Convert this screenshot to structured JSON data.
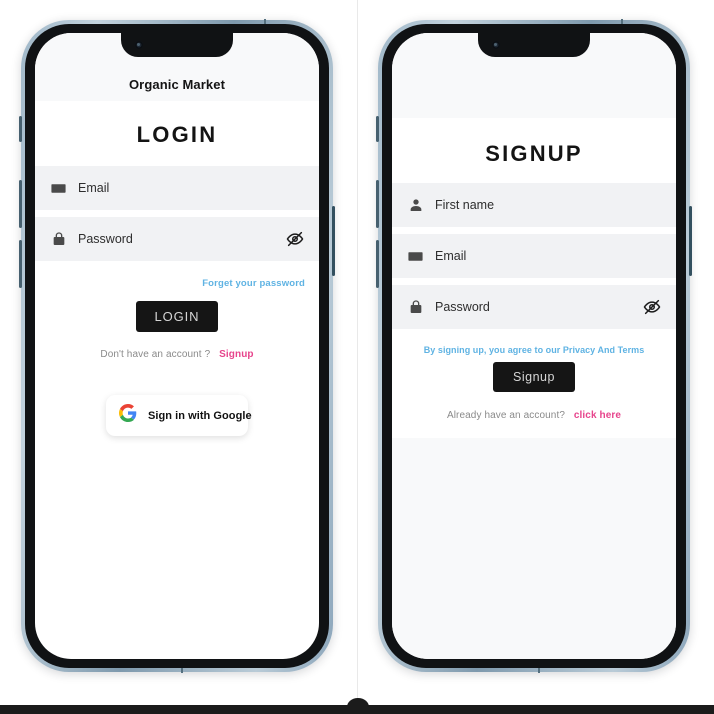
{
  "app": {
    "brand": "Organic Market"
  },
  "login_screen": {
    "title": "LOGIN",
    "fields": [
      {
        "icon": "envelope-icon",
        "label": "Email"
      },
      {
        "icon": "lock-icon",
        "label": "Password",
        "trailing_icon": "eye-off-icon"
      }
    ],
    "forgot_link": "Forget your password",
    "submit_label": "LOGIN",
    "footer_text": "Don't have an account ?",
    "footer_link": "Signup",
    "google_button": {
      "label": "Sign in with Google",
      "icon": "google-g-icon"
    }
  },
  "signup_screen": {
    "title": "SIGNUP",
    "fields": [
      {
        "icon": "person-icon",
        "label": "First name"
      },
      {
        "icon": "envelope-icon",
        "label": "Email"
      },
      {
        "icon": "lock-icon",
        "label": "Password",
        "trailing_icon": "eye-off-icon"
      }
    ],
    "terms_text": "By signing up, you agree to our Privacy And Terms",
    "submit_label": "Signup",
    "footer_text": "Already have an account?",
    "footer_link": "click here"
  },
  "colors": {
    "link_blue": "#5fb3e3",
    "accent_pink": "#e7448c",
    "button_dark": "#151515",
    "field_bg": "#f1f2f4",
    "screen_bg": "#ffffff",
    "band_bg": "#f8f9fa",
    "phone_frame": "#8ca6bb"
  }
}
